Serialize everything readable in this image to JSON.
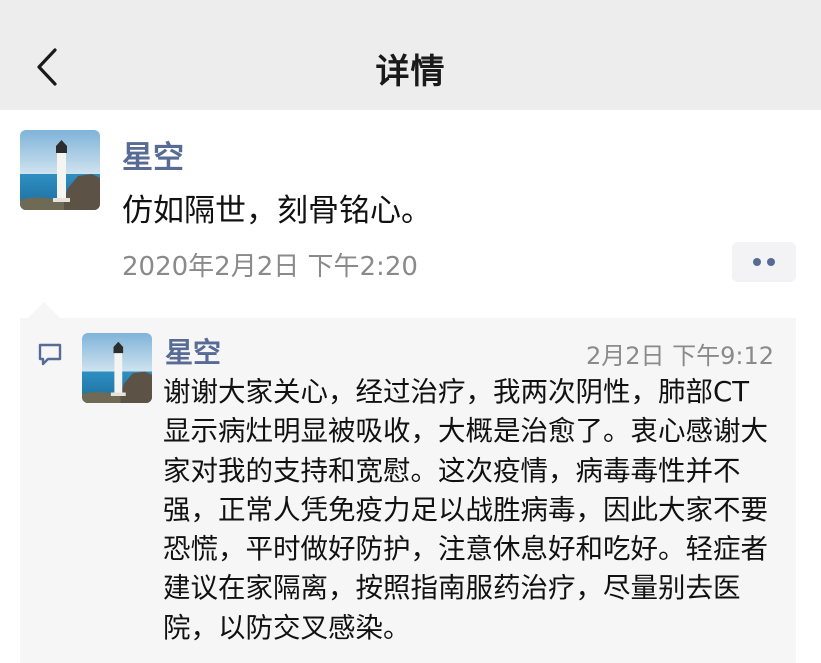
{
  "navbar": {
    "title": "详情",
    "back_icon": "chevron-left-icon"
  },
  "post": {
    "author": "星空",
    "content": "仿如隔世，刻骨铭心。",
    "time": "2020年2月2日 下午2:20",
    "more_icon": "more-dots-icon"
  },
  "comment": {
    "icon": "comment-icon",
    "author": "星空",
    "time": "2月2日 下午9:12",
    "content": "谢谢大家关心，经过治疗，我两次阴性，肺部CT显示病灶明显被吸收，大概是治愈了。衷心感谢大家对我的支持和宽慰。这次疫情，病毒毒性并不强，正常人凭免疫力足以战胜病毒，因此大家不要恐慌，平时做好防护，注意休息好和吃好。轻症者建议在家隔离，按照指南服药治疗，尽量别去医院，以防交叉感染。"
  },
  "colors": {
    "navbar_bg": "#ededed",
    "link_blue": "#576b95",
    "comment_bg": "#f6f6f6",
    "meta_gray": "#8a8a8a"
  }
}
